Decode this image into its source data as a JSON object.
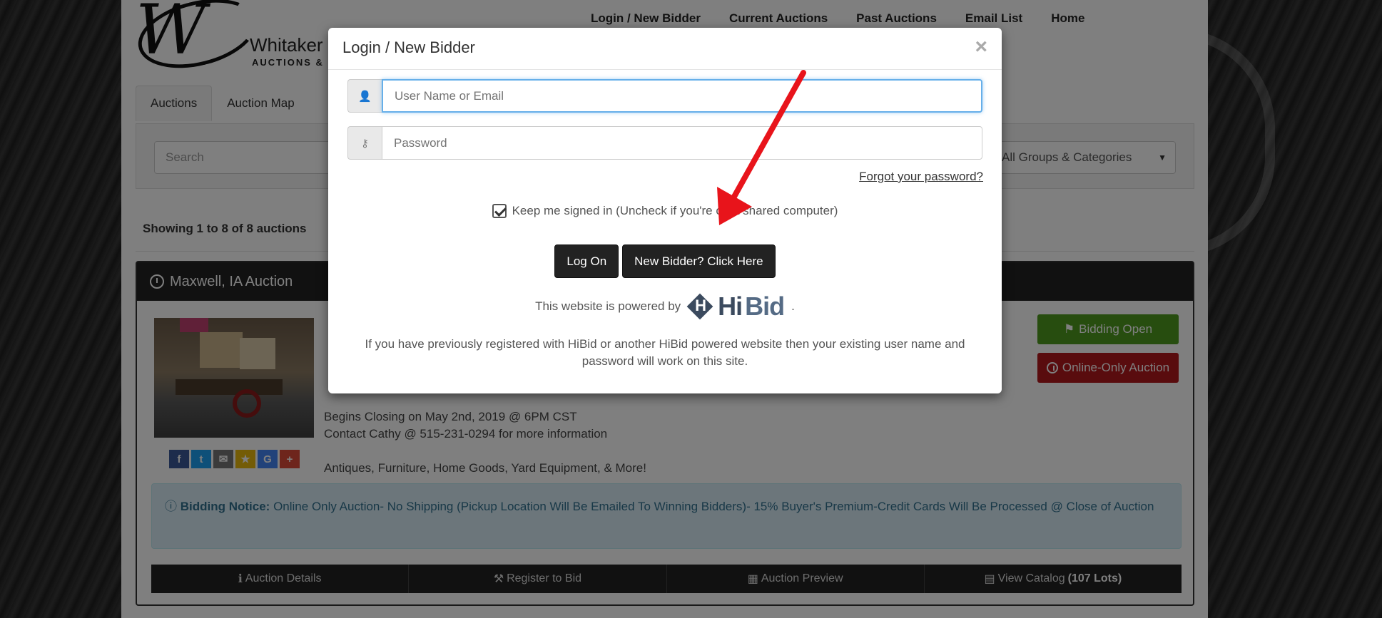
{
  "header": {
    "logo_name": "Whitaker",
    "logo_sub": "AUCTIONS &",
    "nav": [
      "Login / New Bidder",
      "Current Auctions",
      "Past Auctions",
      "Email List",
      "Home"
    ]
  },
  "tabs": [
    "Auctions",
    "Auction Map"
  ],
  "search": {
    "placeholder": "Search",
    "group_select": "All Groups & Categories"
  },
  "showing": "Showing 1 to 8 of 8 auctions",
  "auction": {
    "title": "Maxwell, IA Auction",
    "status_open": "Bidding Open",
    "status_type": "Online-Only Auction",
    "closing": "Begins Closing on May 2nd, 2019 @ 6PM CST",
    "contact": "Contact Cathy @ 515-231-0294 for more information",
    "items": "Antiques, Furniture, Home Goods, Yard Equipment, & More!",
    "notice_label": "Bidding Notice:",
    "notice_text": "Online Only Auction- No Shipping (Pickup Location Will Be Emailed To Winning Bidders)- 15% Buyer's Premium-Credit Cards Will Be Processed @ Close of Auction",
    "actions": {
      "details": "Auction Details",
      "register": "Register to Bid",
      "preview": "Auction Preview",
      "catalog": "View Catalog",
      "catalog_count": "(107 Lots)"
    }
  },
  "modal": {
    "title": "Login / New Bidder",
    "close": "×",
    "username_placeholder": "User Name or Email",
    "password_placeholder": "Password",
    "forgot": "Forgot your password?",
    "keep_signed": "Keep me signed in (Uncheck if you're on a shared computer)",
    "logon": "Log On",
    "new_bidder": "New Bidder? Click Here",
    "powered_by": "This website is powered by",
    "powered_suffix": ".",
    "hibid_hi": "Hi",
    "hibid_bid": "Bid",
    "info": "If you have previously registered with HiBid or another HiBid powered website then your existing user name and password will work on this site."
  },
  "colors": {
    "accent_red": "#e8141b",
    "bidding_open": "#4e9a1f",
    "online_only": "#b3181d",
    "notice_bg": "#d9edf7",
    "focus_blue": "#66afe9"
  }
}
